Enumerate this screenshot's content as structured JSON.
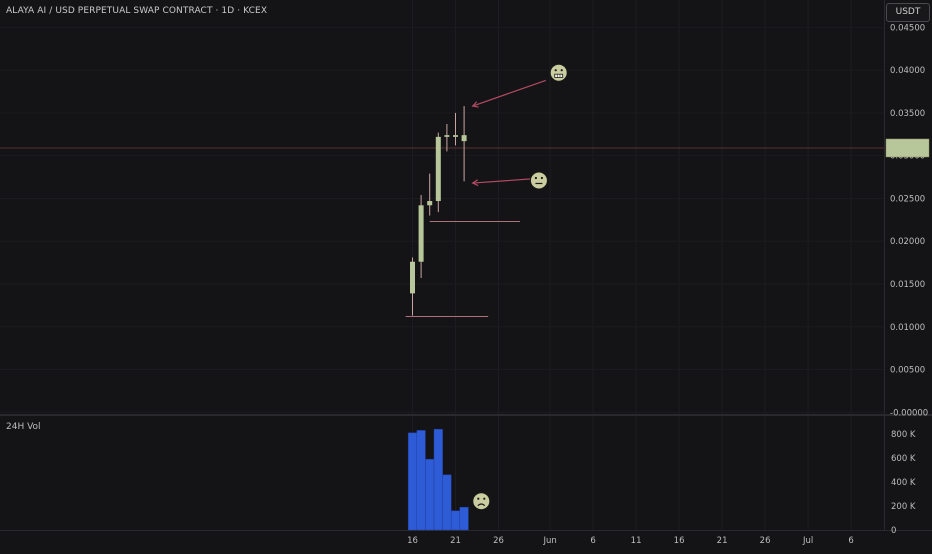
{
  "header": {
    "title": "ALAYA AI / USD PERPETUAL SWAP CONTRACT · 1D · KCEX",
    "currency": "USDT"
  },
  "volume_pane": {
    "title": "24H Vol"
  },
  "colors": {
    "background": "#141416",
    "candle_body": "#b8c79a",
    "candle_wick": "#c8a4a4",
    "volume_bar": "#2e5bd6",
    "annotation_line": "#b34a63",
    "horizontal_line": "#b0707a",
    "emoji_face": "#c9cd9f",
    "price_line": "#5a3030"
  },
  "chart_data": {
    "type": "candlestick",
    "price_axis": {
      "ticks": [
        0.045,
        0.04,
        0.035,
        0.03,
        0.025,
        0.02,
        0.015,
        0.01,
        0.005,
        0.0
      ],
      "tick_labels": [
        "0.04500",
        "0.04000",
        "0.03500",
        "0.03000",
        "0.02500",
        "0.02000",
        "0.01500",
        "0.01000",
        "0.00500",
        "-0.00000"
      ],
      "range": [
        -0.0002,
        0.0482
      ]
    },
    "volume_axis": {
      "ticks": [
        0,
        200000,
        400000,
        600000,
        800000
      ],
      "tick_labels": [
        "0",
        "200 K",
        "400 K",
        "600 K",
        "800 K"
      ],
      "range": [
        0,
        900000
      ]
    },
    "x_axis": {
      "tick_labels": [
        {
          "day": 0,
          "label": "16"
        },
        {
          "day": 5,
          "label": "21"
        },
        {
          "day": 10,
          "label": "26"
        },
        {
          "day": 16,
          "label": "Jun"
        },
        {
          "day": 21,
          "label": "6"
        },
        {
          "day": 26,
          "label": "11"
        },
        {
          "day": 31,
          "label": "16"
        },
        {
          "day": 36,
          "label": "21"
        },
        {
          "day": 41,
          "label": "26"
        },
        {
          "day": 46,
          "label": "Jul"
        },
        {
          "day": 51,
          "label": "6"
        }
      ]
    },
    "candles": [
      {
        "day": 0,
        "open": 0.0139,
        "high": 0.0181,
        "low": 0.0113,
        "close": 0.0176
      },
      {
        "day": 1,
        "open": 0.0176,
        "high": 0.0254,
        "low": 0.0157,
        "close": 0.0242
      },
      {
        "day": 2,
        "open": 0.0242,
        "high": 0.0279,
        "low": 0.023,
        "close": 0.0247
      },
      {
        "day": 3,
        "open": 0.0247,
        "high": 0.0327,
        "low": 0.0234,
        "close": 0.0322
      },
      {
        "day": 4,
        "open": 0.0322,
        "high": 0.0337,
        "low": 0.0305,
        "close": 0.0324
      },
      {
        "day": 5,
        "open": 0.0324,
        "high": 0.035,
        "low": 0.0312,
        "close": 0.0322
      },
      {
        "day": 6,
        "open": 0.0324,
        "high": 0.0358,
        "low": 0.027,
        "close": 0.0317
      }
    ],
    "volumes": [
      {
        "day": 0,
        "value": 810000
      },
      {
        "day": 1,
        "value": 830000
      },
      {
        "day": 2,
        "value": 590000
      },
      {
        "day": 3,
        "value": 840000
      },
      {
        "day": 4,
        "value": 460000
      },
      {
        "day": 5,
        "value": 160000
      },
      {
        "day": 6,
        "value": 190000
      }
    ],
    "current_price": 0.0309,
    "horizontal_lines": [
      {
        "price": 0.0223,
        "from_day": 2,
        "to_day": 12.5
      },
      {
        "price": 0.0112,
        "from_day": -0.8,
        "to_day": 8.8
      }
    ],
    "annotations": [
      {
        "type": "arrow",
        "from_day": 15.5,
        "from_price": 0.0388,
        "to_day": 7.0,
        "to_price": 0.0358
      },
      {
        "type": "arrow",
        "from_day": 14.0,
        "from_price": 0.0273,
        "to_day": 7.0,
        "to_price": 0.0268
      },
      {
        "type": "emoji",
        "mood": "grimace",
        "day": 17.0,
        "price": 0.0397
      },
      {
        "type": "emoji",
        "mood": "neutral",
        "day": 14.7,
        "price": 0.0271
      },
      {
        "type": "emoji",
        "mood": "frown",
        "pane": "volume",
        "day": 8.0,
        "volume": 240000
      }
    ]
  }
}
